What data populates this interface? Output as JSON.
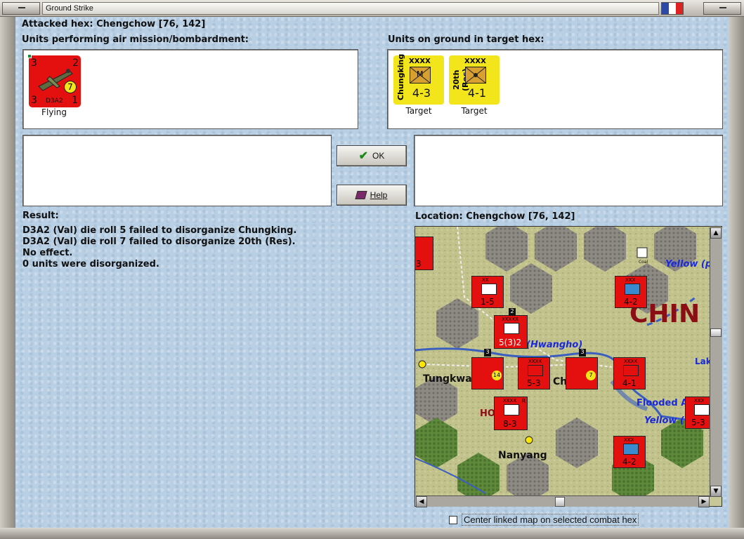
{
  "window": {
    "title": "Ground Strike"
  },
  "header": {
    "attacked_hex": "Attacked hex: Chengchow  [76, 142]"
  },
  "air_units": {
    "label": "Units performing air mission/bombardment:",
    "items": [
      {
        "name": "D3A2",
        "status": "Flying",
        "top_left": "3",
        "top_right": "2",
        "bottom_left": "3",
        "bottom_right": "1",
        "badge": "7",
        "color": "#e41010"
      }
    ]
  },
  "ground_units": {
    "label": "Units on ground in target hex:",
    "items": [
      {
        "name": "Chungking",
        "size": "XXXX",
        "symbol": "M",
        "strength": "4-3",
        "status": "Target",
        "color": "#f3e51c"
      },
      {
        "name": "20th (Res)",
        "size": "XXXX",
        "symbol": "",
        "strength": "4-1",
        "status": "Target",
        "color": "#f3e51c"
      }
    ]
  },
  "buttons": {
    "ok": "OK",
    "help": "Help"
  },
  "result": {
    "label": "Result:",
    "lines": [
      "D3A2 (Val) die roll 5 failed to disorganize Chungking.",
      "D3A2 (Val) die roll 7 failed to disorganize 20th (Res).",
      "No effect.",
      "0 units were disorganized."
    ]
  },
  "location": {
    "label": "Location:  Chengchow  [76, 142]"
  },
  "map": {
    "place_names": [
      "Tungkwa",
      "Nanyang",
      "CHIN",
      "Yellow (p",
      "(Hwangho)",
      "Flooded A",
      "Yellow (",
      "Lak",
      "Ch",
      "HO"
    ],
    "counters": [
      {
        "sym": "XX",
        "str": "1-5"
      },
      {
        "sym": "XXX",
        "str": "4-2"
      },
      {
        "sym": "XXXXX",
        "str": "5(3)2"
      },
      {
        "sym": "XXXX",
        "str": "5-3"
      },
      {
        "sym": "XXXX",
        "str": "4-1"
      },
      {
        "sym": "XXXX",
        "str": "8-3"
      },
      {
        "sym": "XXX",
        "str": "4-2"
      },
      {
        "sym": "XXX",
        "str": "5-3"
      },
      {
        "sym": "",
        "str": "3"
      }
    ],
    "small_tags": [
      "2",
      "3",
      "3",
      "R",
      "14",
      "7",
      "Coal"
    ]
  },
  "center_option": {
    "label": "Center linked map on selected combat hex",
    "checked": false
  },
  "colors": {
    "axis_red": "#e41010",
    "target_yellow": "#f3e51c",
    "panel_blue": "#b8cfe4",
    "ok_green": "#1a8a1a"
  }
}
